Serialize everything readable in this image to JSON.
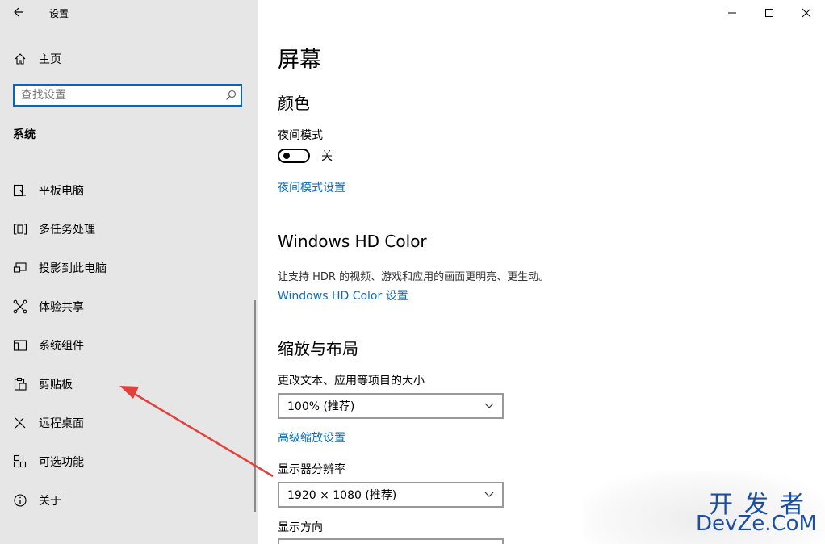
{
  "window": {
    "title": "设置",
    "controls": [
      "minimize",
      "maximize",
      "close"
    ]
  },
  "sidebar": {
    "home_label": "主页",
    "search": {
      "placeholder": "查找设置",
      "value": ""
    },
    "section_label": "系统",
    "items": [
      {
        "label": "平板电脑",
        "icon": "tablet-icon"
      },
      {
        "label": "多任务处理",
        "icon": "multitask-icon"
      },
      {
        "label": "投影到此电脑",
        "icon": "project-icon"
      },
      {
        "label": "体验共享",
        "icon": "share-icon"
      },
      {
        "label": "系统组件",
        "icon": "components-icon"
      },
      {
        "label": "剪贴板",
        "icon": "clipboard-icon"
      },
      {
        "label": "远程桌面",
        "icon": "remote-desktop-icon"
      },
      {
        "label": "可选功能",
        "icon": "optional-features-icon"
      },
      {
        "label": "关于",
        "icon": "info-icon"
      }
    ]
  },
  "content": {
    "page_title": "屏幕",
    "color": {
      "heading": "颜色",
      "night_mode_label": "夜间模式",
      "night_mode_state": "关",
      "night_mode_settings_link": "夜间模式设置"
    },
    "hdr": {
      "heading": "Windows HD Color",
      "description": "让支持 HDR 的视频、游戏和应用的画面更明亮、更生动。",
      "settings_link": "Windows HD Color 设置"
    },
    "scale_layout": {
      "heading": "缩放与布局",
      "scale_label": "更改文本、应用等项目的大小",
      "scale_value": "100% (推荐)",
      "advanced_link": "高级缩放设置",
      "resolution_label": "显示器分辨率",
      "resolution_value": "1920 × 1080 (推荐)",
      "orientation_label": "显示方向"
    }
  },
  "watermark": {
    "cn": "开发者",
    "en": "DevZe.CoM"
  },
  "colors": {
    "sidebar_bg": "#e6e6e6",
    "accent": "#0067c0",
    "link": "#0a6cb8",
    "annotation_arrow": "#e0413a"
  }
}
